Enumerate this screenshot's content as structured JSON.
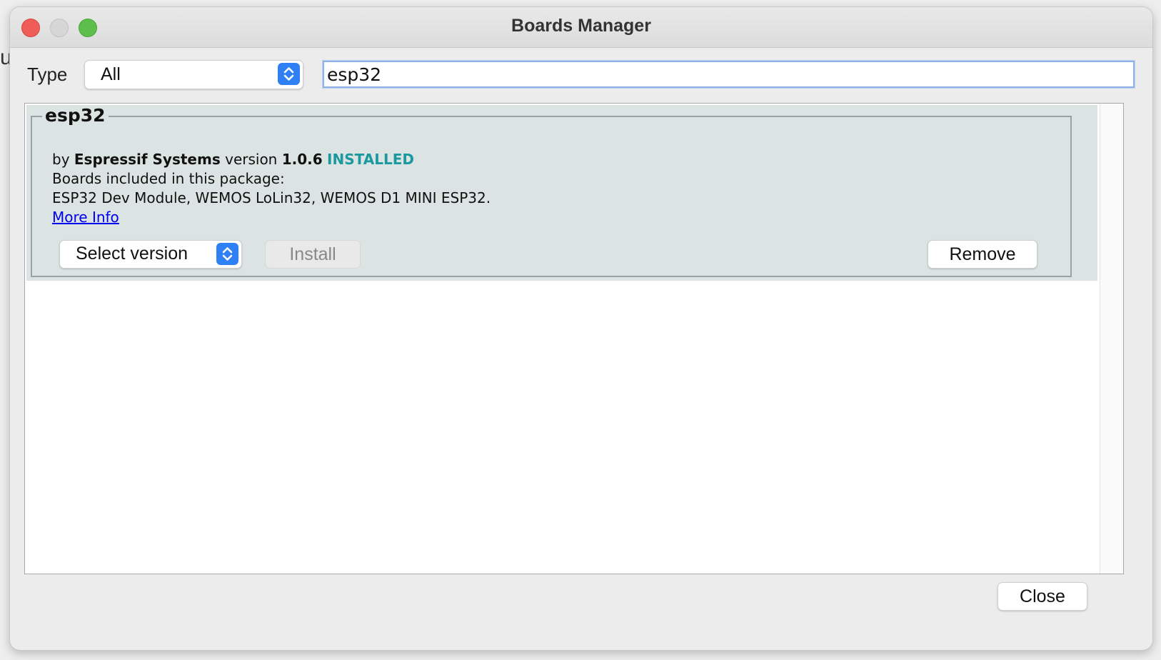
{
  "background": {
    "edge_glyph": "u"
  },
  "window": {
    "title": "Boards Manager"
  },
  "filter": {
    "type_label": "Type",
    "type_value": "All",
    "search_value": "esp32"
  },
  "entry": {
    "name": "esp32",
    "by_label": "by",
    "author": "Espressif Systems",
    "version_label": "version",
    "version": "1.0.6",
    "status": "INSTALLED",
    "boards_label": "Boards included in this package:",
    "boards": "ESP32 Dev Module, WEMOS LoLin32, WEMOS D1 MINI ESP32.",
    "more_info": "More Info",
    "select_version": "Select version",
    "install_label": "Install",
    "remove_label": "Remove"
  },
  "footer": {
    "close_label": "Close"
  },
  "colors": {
    "installed": "#1a9aa0",
    "link": "#0000ee",
    "accent": "#2f7ff5",
    "entry_bg": "#dce3e3"
  }
}
